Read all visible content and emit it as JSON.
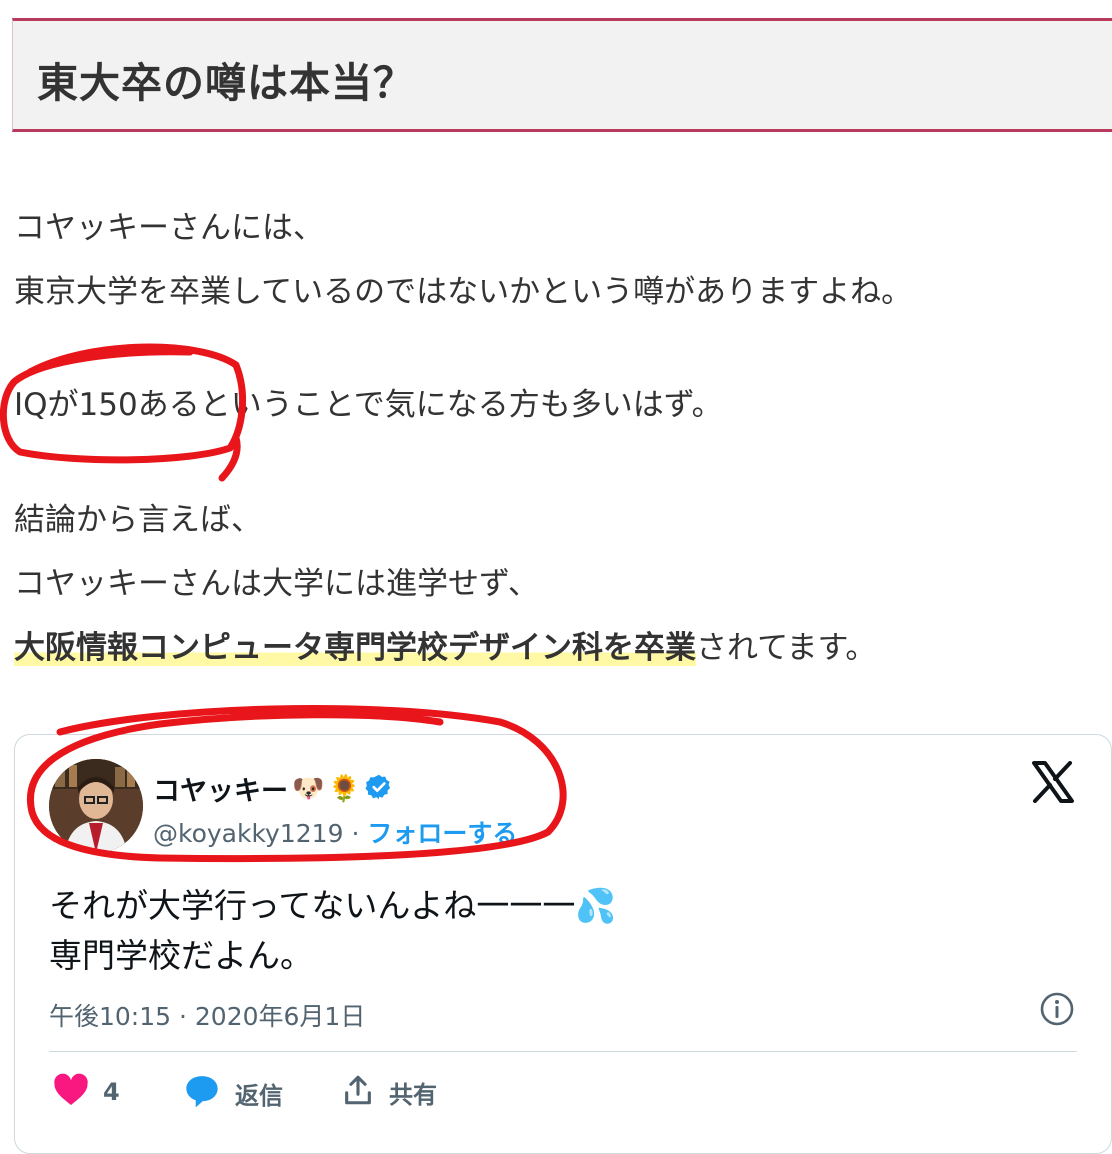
{
  "article": {
    "heading": "東大卒の噂は本当？",
    "lines": [
      "コヤッキーさんには、",
      "東京大学を卒業しているのではないかという噂がありますよね。",
      "IQが150あるということで気になる方も多いはず。",
      "結論から言えば、",
      "コヤッキーさんは大学には進学せず、"
    ],
    "final_line": {
      "highlight": "大阪情報コンピュータ専門学校デザイン科を卒業",
      "rest": "されてます。"
    }
  },
  "tweet": {
    "display_name": "コヤッキー",
    "name_emojis": [
      "🐶",
      "🌻"
    ],
    "handle": "@koyakky1219",
    "separator": "·",
    "follow_label": "フォローする",
    "text_lines": [
      "それが大学行ってないんよね一一一",
      "専門学校だよん。"
    ],
    "text_emoji": "💦",
    "timestamp": "午後10:15 · 2020年6月1日",
    "like_count": "4",
    "reply_label": "返信",
    "share_label": "共有"
  },
  "colors": {
    "heading_border": "#b83b5e",
    "highlight": "#fff9a6",
    "follow_blue": "#1d9bf0",
    "like_pink": "#f91880",
    "annotation_red": "#e8161b"
  },
  "icons": [
    "verified-badge-icon",
    "x-logo-icon",
    "info-icon",
    "heart-icon",
    "reply-icon",
    "share-icon"
  ]
}
